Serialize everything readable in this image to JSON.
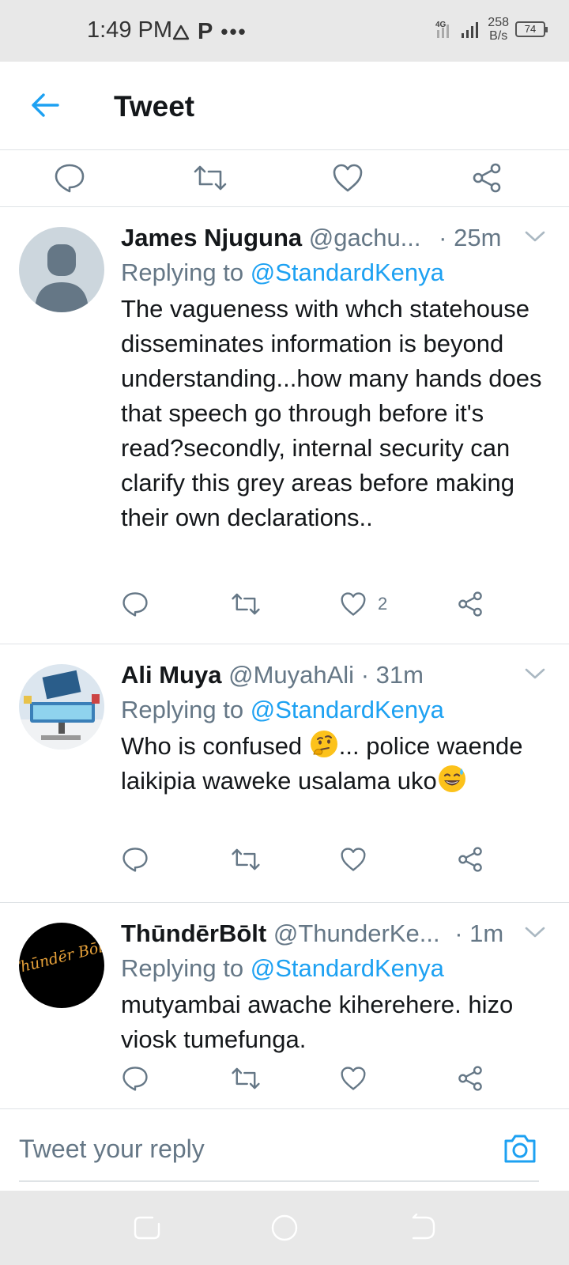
{
  "status_bar": {
    "time": "1:49 PM",
    "carrier_p": "P",
    "network": "4G",
    "speed_value": "258",
    "speed_unit": "B/s",
    "battery": "74"
  },
  "header": {
    "title": "Tweet"
  },
  "tweets": [
    {
      "name": "James Njuguna",
      "handle": "@gachu...",
      "time": "· 25m",
      "replying_prefix": "Replying to ",
      "replying_to": "@StandardKenya",
      "text": "The vagueness with whch statehouse disseminates information is beyond understanding...how many hands does that speech go through before it's read?secondly, internal security can clarify this grey areas before making their own declarations..",
      "likes": "2"
    },
    {
      "name": "Ali Muya",
      "handle": "@MuyahAli",
      "time": "· 31m",
      "replying_prefix": "Replying to ",
      "replying_to": "@StandardKenya",
      "text_part1": "Who is confused ",
      "text_part2": "... police waende laikipia waweke usalama uko",
      "likes": ""
    },
    {
      "name": "ThūndērBōlt",
      "handle": "@ThunderKe...",
      "time": "· 1m",
      "replying_prefix": "Replying to ",
      "replying_to": "@StandardKenya",
      "text": "mutyambai awache kiherehere. hizo viosk tumefunga.",
      "likes": "",
      "avatar_text": "Thūndēr Bōlt"
    }
  ],
  "composer": {
    "placeholder": "Tweet your reply"
  },
  "colors": {
    "accent": "#1da1f2",
    "secondary_text": "#657786",
    "primary_text": "#14171a",
    "divider": "#dfe3e6"
  }
}
